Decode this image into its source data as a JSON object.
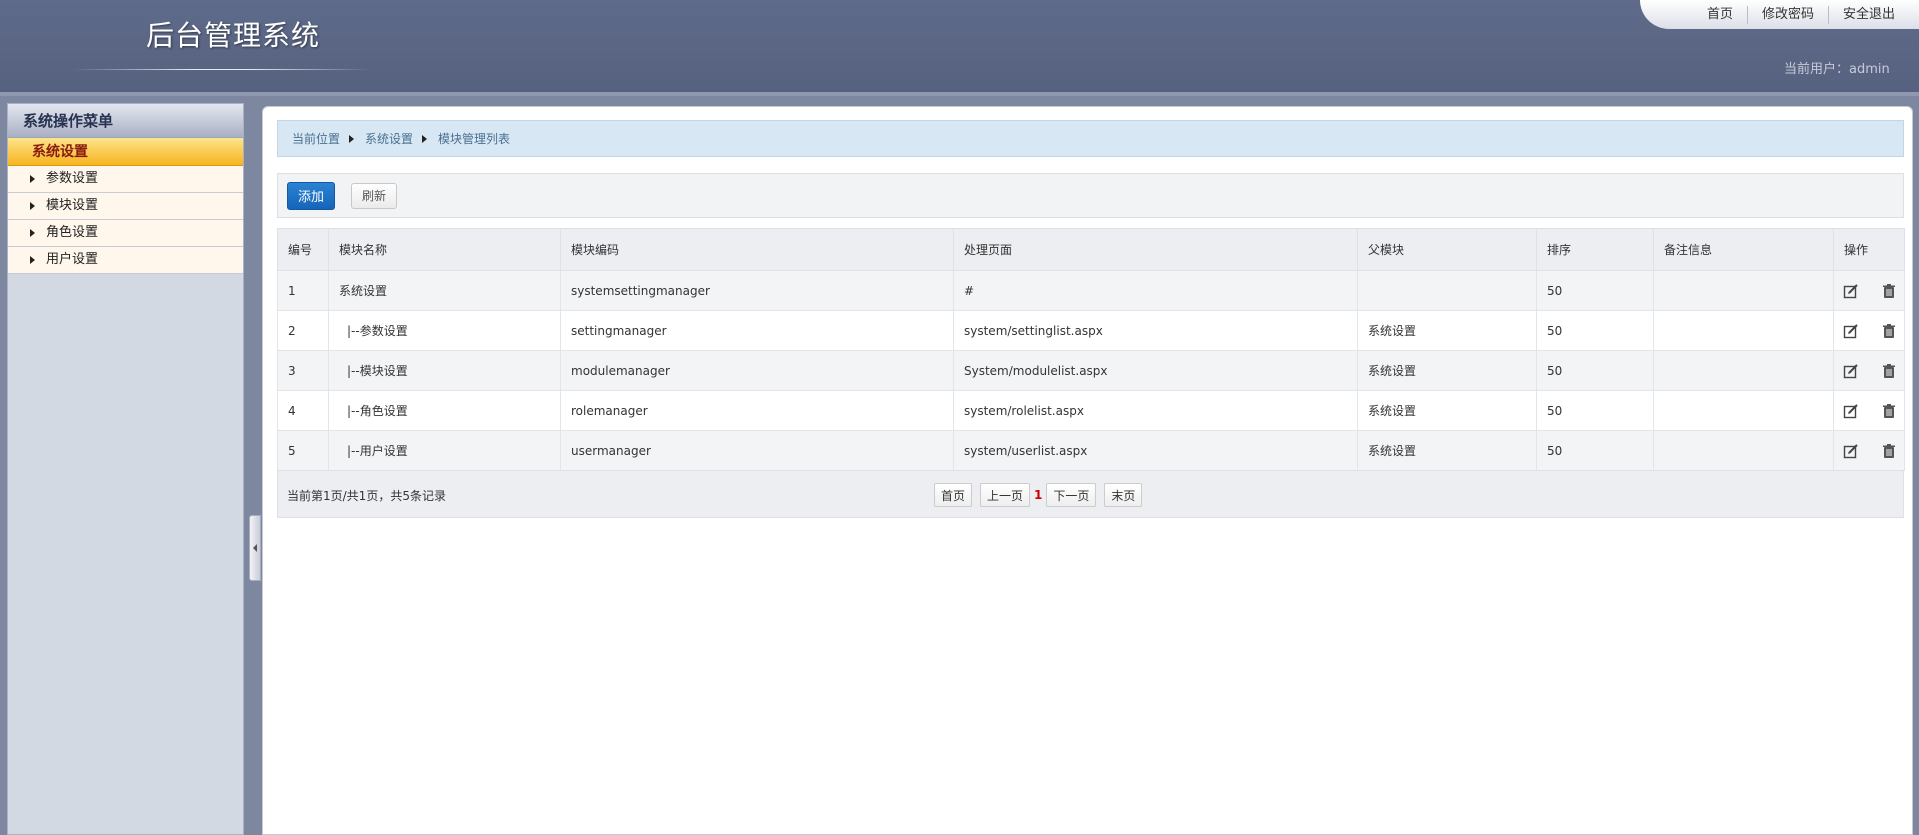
{
  "header": {
    "title": "后台管理系统",
    "top_links": [
      "首页",
      "修改密码",
      "安全退出"
    ],
    "current_user_label": "当前用户：",
    "current_user_value": "admin"
  },
  "sidebar": {
    "title": "系统操作菜单",
    "section": "系统设置",
    "items": [
      "参数设置",
      "模块设置",
      "角色设置",
      "用户设置"
    ]
  },
  "breadcrumb": [
    "当前位置",
    "系统设置",
    "模块管理列表"
  ],
  "toolbar": {
    "add_label": "添加",
    "refresh_label": "刷新"
  },
  "table": {
    "columns": [
      "编号",
      "模块名称",
      "模块编码",
      "处理页面",
      "父模块",
      "排序",
      "备注信息",
      "操作"
    ],
    "rows": [
      {
        "id": "1",
        "name": "系统设置",
        "code": "systemsettingmanager",
        "page": "#",
        "parent": "",
        "order": "50",
        "note": ""
      },
      {
        "id": "2",
        "name": "|--参数设置",
        "code": "settingmanager",
        "page": "system/settinglist.aspx",
        "parent": "系统设置",
        "order": "50",
        "note": ""
      },
      {
        "id": "3",
        "name": "|--模块设置",
        "code": "modulemanager",
        "page": "System/modulelist.aspx",
        "parent": "系统设置",
        "order": "50",
        "note": ""
      },
      {
        "id": "4",
        "name": "|--角色设置",
        "code": "rolemanager",
        "page": "system/rolelist.aspx",
        "parent": "系统设置",
        "order": "50",
        "note": ""
      },
      {
        "id": "5",
        "name": "|--用户设置",
        "code": "usermanager",
        "page": "system/userlist.aspx",
        "parent": "系统设置",
        "order": "50",
        "note": ""
      }
    ]
  },
  "pager": {
    "info": "当前第1页/共1页，共5条记录",
    "first": "首页",
    "prev": "上一页",
    "current": "1",
    "next": "下一页",
    "last": "末页"
  },
  "icons": {
    "row_edit": "edit-icon",
    "row_delete": "trash-icon",
    "menu_bullet": "triangle-right-icon",
    "collapse": "chevron-left-icon"
  },
  "colors": {
    "header_bg": "#5a6583",
    "section_bg": "#f6b51e",
    "primary_button": "#1b6fc4",
    "breadcrumb_bg": "#d7e7f3",
    "current_page": "#cc0000"
  }
}
